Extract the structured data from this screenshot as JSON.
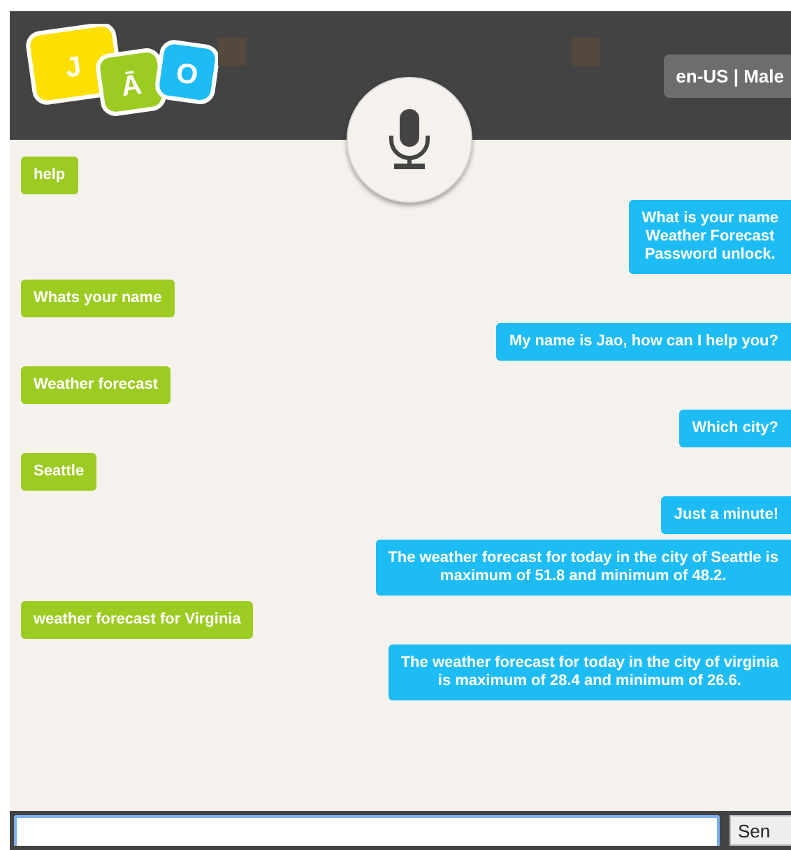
{
  "header": {
    "logo_letters": [
      "J",
      "Ā",
      "O"
    ],
    "language_badge": "en-US | Male"
  },
  "messages": [
    {
      "kind": "user",
      "text": "help"
    },
    {
      "kind": "bot",
      "text": "What is your name\nWeather Forecast\nPassword unlock."
    },
    {
      "kind": "user",
      "text": "Whats your name"
    },
    {
      "kind": "bot",
      "text": "My name is Jao, how can I help you?"
    },
    {
      "kind": "user",
      "text": "Weather forecast"
    },
    {
      "kind": "bot",
      "text": "Which city?"
    },
    {
      "kind": "user",
      "text": "Seattle"
    },
    {
      "kind": "bot",
      "text": "Just a minute!"
    },
    {
      "kind": "bot",
      "text": "The weather forecast for today in the city of Seattle is\nmaximum of 51.8 and minimum of 48.2."
    },
    {
      "kind": "user",
      "text": "weather forecast for Virginia"
    },
    {
      "kind": "bot",
      "text": "The weather forecast for today in the city of virginia\nis maximum of 28.4 and minimum of 26.6."
    }
  ],
  "composer": {
    "send_button": "Sen"
  }
}
